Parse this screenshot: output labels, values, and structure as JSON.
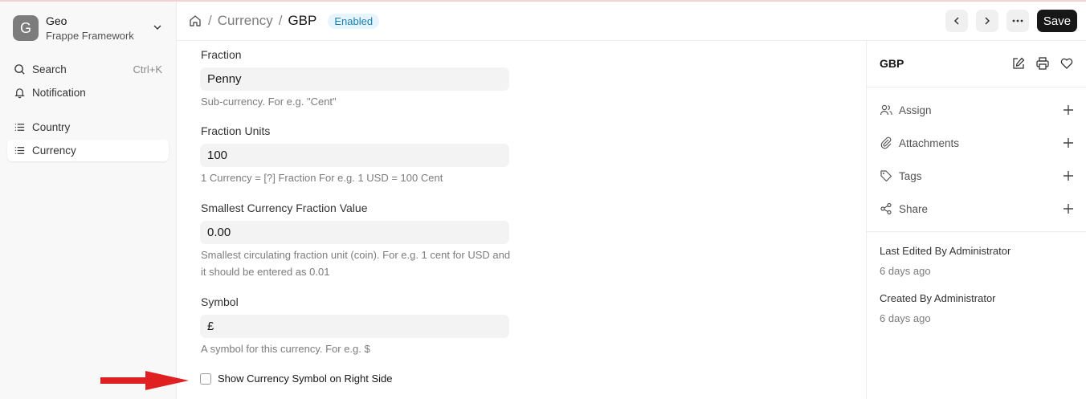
{
  "sidebar": {
    "app": {
      "initial": "G",
      "name": "Geo",
      "subtitle": "Frappe Framework"
    },
    "search_label": "Search",
    "search_shortcut": "Ctrl+K",
    "notification_label": "Notification",
    "items": [
      {
        "label": "Country",
        "active": false
      },
      {
        "label": "Currency",
        "active": true
      }
    ]
  },
  "header": {
    "breadcrumb": [
      "Currency",
      "GBP"
    ],
    "status_badge": "Enabled",
    "save_label": "Save"
  },
  "form": {
    "fraction": {
      "label": "Fraction",
      "value": "Penny",
      "help": "Sub-currency. For e.g. \"Cent\""
    },
    "fraction_units": {
      "label": "Fraction Units",
      "value": "100",
      "help": "1 Currency = [?] Fraction For e.g. 1 USD = 100 Cent"
    },
    "smallest_fraction": {
      "label": "Smallest Currency Fraction Value",
      "value": "0.00",
      "help": "Smallest circulating fraction unit (coin). For e.g. 1 cent for USD and it should be entered as 0.01"
    },
    "symbol": {
      "label": "Symbol",
      "value": "£",
      "help": "A symbol for this currency. For e.g. $"
    },
    "symbol_right": {
      "label": "Show Currency Symbol on Right Side",
      "checked": false
    }
  },
  "right_panel": {
    "title": "GBP",
    "actions": [
      "Assign",
      "Attachments",
      "Tags",
      "Share"
    ],
    "last_edited": "Last Edited By Administrator",
    "last_edited_ago": "6 days ago",
    "created": "Created By Administrator",
    "created_ago": "6 days ago"
  },
  "colors": {
    "accent": "#171717",
    "badge_bg": "#e6f4fc",
    "badge_text": "#1a7fb0",
    "annotation_arrow": "#e02020"
  }
}
